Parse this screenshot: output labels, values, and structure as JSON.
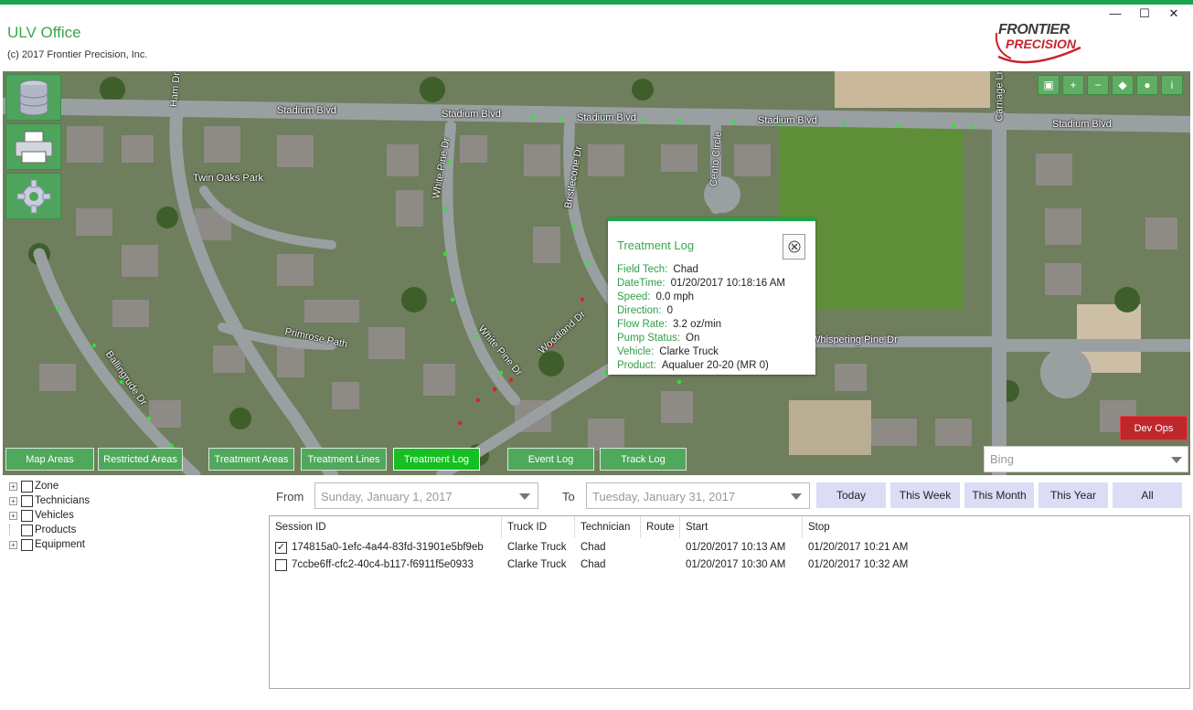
{
  "header": {
    "title": "ULV Office",
    "copyright": "(c) 2017 Frontier Precision, Inc.",
    "logo_line1": "FRONTIER",
    "logo_line2": "PRECISION",
    "accent_color": "#1aa34a"
  },
  "window": {
    "minimize": "—",
    "maximize": "☐",
    "close": "✕"
  },
  "side_tools": [
    {
      "name": "database-icon"
    },
    {
      "name": "printer-icon"
    },
    {
      "name": "gear-icon"
    }
  ],
  "map_tools": [
    {
      "name": "layers-icon",
      "glyph": "▣"
    },
    {
      "name": "zoom-in-icon",
      "glyph": "+"
    },
    {
      "name": "zoom-out-icon",
      "glyph": "−"
    },
    {
      "name": "tag-icon",
      "glyph": "◆"
    },
    {
      "name": "globe-icon",
      "glyph": "●"
    },
    {
      "name": "info-icon",
      "glyph": "i"
    }
  ],
  "streets": {
    "s1": "Stadium Blvd",
    "s2": "Stadium Blvd",
    "s3": "Stadium Blvd",
    "s4": "Stadium Blvd",
    "s5": "Stadium Blvd",
    "twin_oaks": "Twin Oaks Park",
    "white_pine1": "White Pine Dr",
    "white_pine2": "White Pine Dr",
    "bristlecone": "Bristlecone Dr",
    "cento": "Cento Circle",
    "primrose": "Primrose Path",
    "ballingrude": "Ballingrude Dr",
    "woodland": "Woodland Dr",
    "whispering": "Whispering Pine Dr",
    "carriage": "Carriage Ln",
    "ham": "Ham Dr"
  },
  "map_tabs": [
    "Map Areas",
    "Restricted Areas",
    "Treatment Areas",
    "Treatment Lines",
    "Treatment Log",
    "Event Log",
    "Track Log"
  ],
  "active_tab": "Treatment Log",
  "devops_label": "Dev Ops",
  "map_provider": "Bing",
  "popup": {
    "title": "Treatment Log",
    "rows": [
      {
        "key": "Field Tech:",
        "value": "Chad"
      },
      {
        "key": "DateTime:",
        "value": "01/20/2017 10:18:16 AM"
      },
      {
        "key": "Speed:",
        "value": "0.0 mph"
      },
      {
        "key": "Direction:",
        "value": "0"
      },
      {
        "key": "Flow Rate:",
        "value": "3.2 oz/min"
      },
      {
        "key": "Pump Status:",
        "value": "On"
      },
      {
        "key": "Vehicle:",
        "value": "Clarke Truck"
      },
      {
        "key": "Product:",
        "value": "Aqualuer 20-20 (MR 0)"
      }
    ]
  },
  "tree": [
    {
      "label": "Zone",
      "expandable": true
    },
    {
      "label": "Technicians",
      "expandable": true
    },
    {
      "label": "Vehicles",
      "expandable": true
    },
    {
      "label": "Products",
      "expandable": false
    },
    {
      "label": "Equipment",
      "expandable": true
    }
  ],
  "filter": {
    "from_label": "From",
    "from_value": "Sunday, January 1, 2017",
    "to_label": "To",
    "to_value": "Tuesday, January 31, 2017",
    "ranges": [
      "Today",
      "This Week",
      "This Month",
      "This Year",
      "All"
    ]
  },
  "grid": {
    "columns": [
      "Session ID",
      "Truck ID",
      "Technician",
      "Route",
      "Start",
      "Stop"
    ],
    "rows": [
      {
        "checked": true,
        "session": "174815a0-1efc-4a44-83fd-31901e5bf9eb",
        "truck": "Clarke Truck",
        "tech": "Chad",
        "route": "",
        "start": "01/20/2017 10:13 AM",
        "stop": "01/20/2017 10:21 AM"
      },
      {
        "checked": false,
        "session": "7ccbe6ff-cfc2-40c4-b117-f6911f5e0933",
        "truck": "Clarke Truck",
        "tech": "Chad",
        "route": "",
        "start": "01/20/2017 10:30 AM",
        "stop": "01/20/2017 10:32 AM"
      }
    ]
  }
}
